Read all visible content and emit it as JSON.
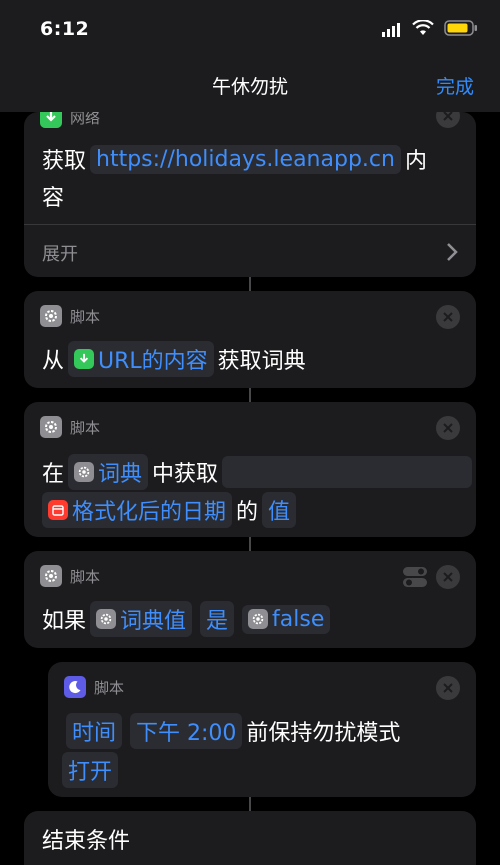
{
  "status": {
    "time": "6:12"
  },
  "nav": {
    "title": "午休勿扰",
    "done": "完成"
  },
  "card1": {
    "category": "网络",
    "verb": "获取",
    "url": "https://holidays.leanapp.cn",
    "suffix": "内",
    "suffix2": "容",
    "expand": "展开"
  },
  "card2": {
    "category": "脚本",
    "from": "从",
    "token": "URL的内容",
    "action": "获取词典"
  },
  "card3": {
    "category": "脚本",
    "in": "在",
    "dict": "词典",
    "get": "中获取",
    "date_token": "格式化后的日期",
    "of": "的",
    "value": "值"
  },
  "card4": {
    "category": "脚本",
    "if": "如果",
    "dict_value": "词典值",
    "is": "是",
    "false": "false"
  },
  "card5": {
    "category": "脚本",
    "time": "时间",
    "pm": "下午 2:00",
    "keep": "前保持勿扰模式",
    "on": "打开"
  },
  "card6": {
    "label": "结束条件"
  },
  "colors": {
    "accent": "#2f8cff",
    "token_blue": "#3f8efc",
    "network_green": "#34c759",
    "calendar_red": "#ff3b30",
    "moon_purple": "#5e5ce6"
  },
  "icons": [
    "download-icon",
    "gear-icon",
    "calendar-icon",
    "moon-icon",
    "close-icon",
    "chevron-right-icon",
    "toggle-icon",
    "signal-icon",
    "wifi-icon",
    "battery-icon"
  ]
}
